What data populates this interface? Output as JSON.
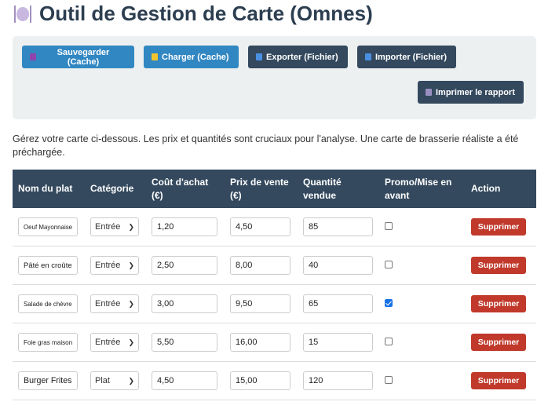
{
  "title": "Outil de Gestion de Carte (Omnes)",
  "toolbar": {
    "save": "Sauvegarder (Cache)",
    "load": "Charger (Cache)",
    "export": "Exporter (Fichier)",
    "import": "Importer (Fichier)",
    "print": "Imprimer le rapport"
  },
  "description": "Gérez votre carte ci-dessous. Les prix et quantités sont cruciaux pour l'analyse. Une carte de brasserie réaliste a été préchargée.",
  "table": {
    "headers": [
      "Nom du plat",
      "Catégorie",
      "Coût d'achat (€)",
      "Prix de vente (€)",
      "Quantité vendue",
      "Promo/Mise en avant",
      "Action"
    ],
    "rows": [
      {
        "name": "Oeuf Mayonnaise",
        "category": "Entrée",
        "cost": "1,20",
        "price": "4,50",
        "qty": "85",
        "promo": false,
        "action": "Supprimer"
      },
      {
        "name": "Pâté en croûte",
        "category": "Entrée",
        "cost": "2,50",
        "price": "8,00",
        "qty": "40",
        "promo": false,
        "action": "Supprimer"
      },
      {
        "name": "Salade de chèvre",
        "category": "Entrée",
        "cost": "3,00",
        "price": "9,50",
        "qty": "65",
        "promo": true,
        "action": "Supprimer"
      },
      {
        "name": "Foie gras maison",
        "category": "Entrée",
        "cost": "5,50",
        "price": "16,00",
        "qty": "15",
        "promo": false,
        "action": "Supprimer"
      },
      {
        "name": "Burger Frites",
        "category": "Plat",
        "cost": "4,50",
        "price": "15,00",
        "qty": "120",
        "promo": false,
        "action": "Supprimer"
      }
    ]
  }
}
